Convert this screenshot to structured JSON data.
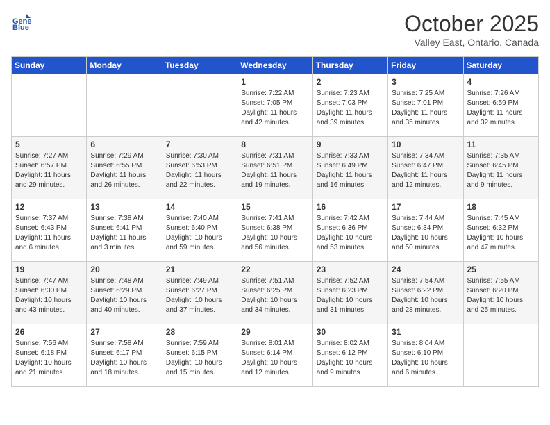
{
  "header": {
    "logo_line1": "General",
    "logo_line2": "Blue",
    "month": "October 2025",
    "location": "Valley East, Ontario, Canada"
  },
  "weekdays": [
    "Sunday",
    "Monday",
    "Tuesday",
    "Wednesday",
    "Thursday",
    "Friday",
    "Saturday"
  ],
  "weeks": [
    [
      {
        "day": "",
        "info": ""
      },
      {
        "day": "",
        "info": ""
      },
      {
        "day": "",
        "info": ""
      },
      {
        "day": "1",
        "sunrise": "7:22 AM",
        "sunset": "7:05 PM",
        "daylight": "11 hours and 42 minutes."
      },
      {
        "day": "2",
        "sunrise": "7:23 AM",
        "sunset": "7:03 PM",
        "daylight": "11 hours and 39 minutes."
      },
      {
        "day": "3",
        "sunrise": "7:25 AM",
        "sunset": "7:01 PM",
        "daylight": "11 hours and 35 minutes."
      },
      {
        "day": "4",
        "sunrise": "7:26 AM",
        "sunset": "6:59 PM",
        "daylight": "11 hours and 32 minutes."
      }
    ],
    [
      {
        "day": "5",
        "sunrise": "7:27 AM",
        "sunset": "6:57 PM",
        "daylight": "11 hours and 29 minutes."
      },
      {
        "day": "6",
        "sunrise": "7:29 AM",
        "sunset": "6:55 PM",
        "daylight": "11 hours and 26 minutes."
      },
      {
        "day": "7",
        "sunrise": "7:30 AM",
        "sunset": "6:53 PM",
        "daylight": "11 hours and 22 minutes."
      },
      {
        "day": "8",
        "sunrise": "7:31 AM",
        "sunset": "6:51 PM",
        "daylight": "11 hours and 19 minutes."
      },
      {
        "day": "9",
        "sunrise": "7:33 AM",
        "sunset": "6:49 PM",
        "daylight": "11 hours and 16 minutes."
      },
      {
        "day": "10",
        "sunrise": "7:34 AM",
        "sunset": "6:47 PM",
        "daylight": "11 hours and 12 minutes."
      },
      {
        "day": "11",
        "sunrise": "7:35 AM",
        "sunset": "6:45 PM",
        "daylight": "11 hours and 9 minutes."
      }
    ],
    [
      {
        "day": "12",
        "sunrise": "7:37 AM",
        "sunset": "6:43 PM",
        "daylight": "11 hours and 6 minutes."
      },
      {
        "day": "13",
        "sunrise": "7:38 AM",
        "sunset": "6:41 PM",
        "daylight": "11 hours and 3 minutes."
      },
      {
        "day": "14",
        "sunrise": "7:40 AM",
        "sunset": "6:40 PM",
        "daylight": "10 hours and 59 minutes."
      },
      {
        "day": "15",
        "sunrise": "7:41 AM",
        "sunset": "6:38 PM",
        "daylight": "10 hours and 56 minutes."
      },
      {
        "day": "16",
        "sunrise": "7:42 AM",
        "sunset": "6:36 PM",
        "daylight": "10 hours and 53 minutes."
      },
      {
        "day": "17",
        "sunrise": "7:44 AM",
        "sunset": "6:34 PM",
        "daylight": "10 hours and 50 minutes."
      },
      {
        "day": "18",
        "sunrise": "7:45 AM",
        "sunset": "6:32 PM",
        "daylight": "10 hours and 47 minutes."
      }
    ],
    [
      {
        "day": "19",
        "sunrise": "7:47 AM",
        "sunset": "6:30 PM",
        "daylight": "10 hours and 43 minutes."
      },
      {
        "day": "20",
        "sunrise": "7:48 AM",
        "sunset": "6:29 PM",
        "daylight": "10 hours and 40 minutes."
      },
      {
        "day": "21",
        "sunrise": "7:49 AM",
        "sunset": "6:27 PM",
        "daylight": "10 hours and 37 minutes."
      },
      {
        "day": "22",
        "sunrise": "7:51 AM",
        "sunset": "6:25 PM",
        "daylight": "10 hours and 34 minutes."
      },
      {
        "day": "23",
        "sunrise": "7:52 AM",
        "sunset": "6:23 PM",
        "daylight": "10 hours and 31 minutes."
      },
      {
        "day": "24",
        "sunrise": "7:54 AM",
        "sunset": "6:22 PM",
        "daylight": "10 hours and 28 minutes."
      },
      {
        "day": "25",
        "sunrise": "7:55 AM",
        "sunset": "6:20 PM",
        "daylight": "10 hours and 25 minutes."
      }
    ],
    [
      {
        "day": "26",
        "sunrise": "7:56 AM",
        "sunset": "6:18 PM",
        "daylight": "10 hours and 21 minutes."
      },
      {
        "day": "27",
        "sunrise": "7:58 AM",
        "sunset": "6:17 PM",
        "daylight": "10 hours and 18 minutes."
      },
      {
        "day": "28",
        "sunrise": "7:59 AM",
        "sunset": "6:15 PM",
        "daylight": "10 hours and 15 minutes."
      },
      {
        "day": "29",
        "sunrise": "8:01 AM",
        "sunset": "6:14 PM",
        "daylight": "10 hours and 12 minutes."
      },
      {
        "day": "30",
        "sunrise": "8:02 AM",
        "sunset": "6:12 PM",
        "daylight": "10 hours and 9 minutes."
      },
      {
        "day": "31",
        "sunrise": "8:04 AM",
        "sunset": "6:10 PM",
        "daylight": "10 hours and 6 minutes."
      },
      {
        "day": "",
        "info": ""
      }
    ]
  ]
}
